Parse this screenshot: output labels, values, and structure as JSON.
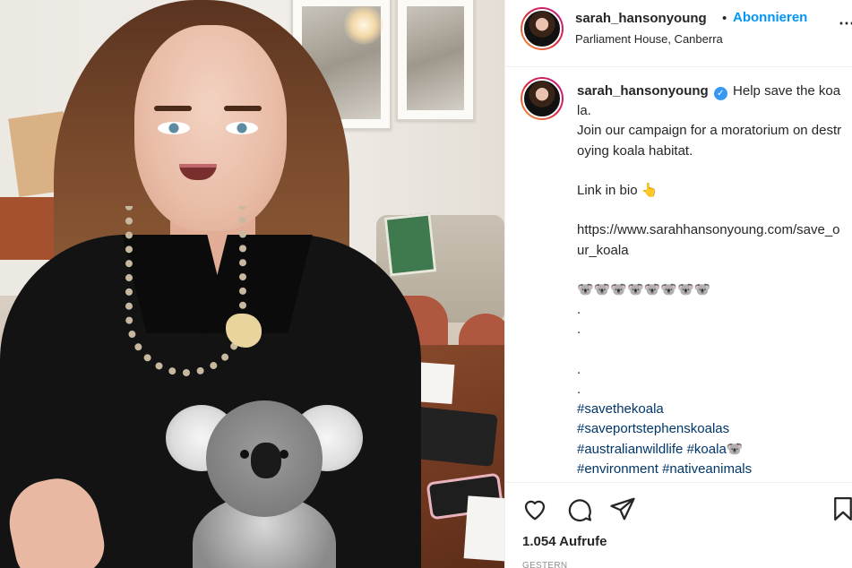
{
  "post": {
    "username": "sarah_hansonyoung",
    "follow_separator": "•",
    "follow_label": "Abonnieren",
    "location": "Parliament House, Canberra",
    "more_icon": "more-horizontal-icon"
  },
  "caption": {
    "username": "sarah_hansonyoung",
    "verified_icon": "verified-badge-icon",
    "line1": "Help save the koala.",
    "line2": "Join our campaign for a moratorium on destroying koala habitat.",
    "line3": "Link in bio 👆",
    "line4": "https://www.sarahhansonyoung.com/save_our_koala",
    "line5": "🐨🐨🐨🐨🐨🐨🐨🐨",
    "dot1": ".",
    "dot2": ".",
    "dot3": ".",
    "dot4": ".",
    "hashtags": [
      "#savethekoala",
      "#saveportstephenskoalas",
      "#australianwildlife",
      "#koala🐨",
      "#environment",
      "#nativeanimals"
    ]
  },
  "actions": {
    "like_icon": "heart-icon",
    "comment_icon": "comment-bubble-icon",
    "share_icon": "paper-plane-icon",
    "save_icon": "bookmark-icon"
  },
  "stats": {
    "views": "1.054 Aufrufe",
    "date": "GESTERN"
  },
  "colors": {
    "accent": "#0095f6",
    "hashtag": "#00376b",
    "verified": "#3897f0"
  }
}
